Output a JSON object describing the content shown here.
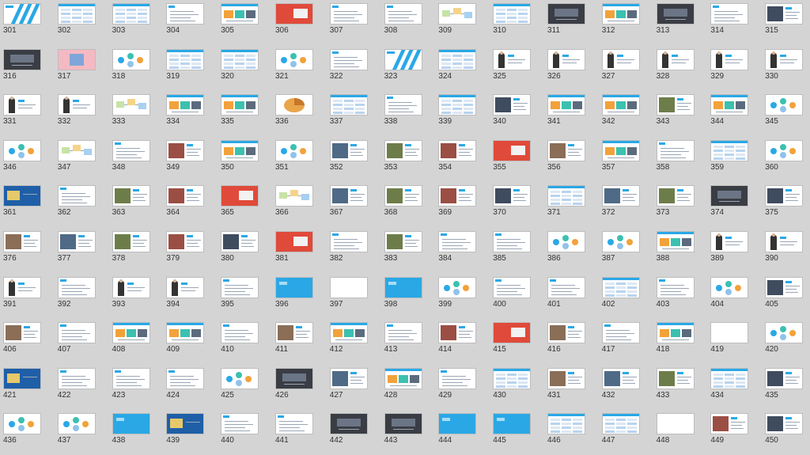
{
  "view": "slide-sorter",
  "slides": [
    {
      "n": "301",
      "s": "stripes"
    },
    {
      "n": "302",
      "s": "table"
    },
    {
      "n": "303",
      "s": "table"
    },
    {
      "n": "304",
      "s": "text"
    },
    {
      "n": "305",
      "s": "tiles"
    },
    {
      "n": "306",
      "s": "photo-red"
    },
    {
      "n": "307",
      "s": "text"
    },
    {
      "n": "308",
      "s": "text"
    },
    {
      "n": "309",
      "s": "diagram"
    },
    {
      "n": "310",
      "s": "table"
    },
    {
      "n": "311",
      "s": "photo-dark"
    },
    {
      "n": "312",
      "s": "tiles"
    },
    {
      "n": "313",
      "s": "photo-dark"
    },
    {
      "n": "314",
      "s": "text"
    },
    {
      "n": "315",
      "s": "photo"
    },
    {
      "n": "316",
      "s": "photo-dark"
    },
    {
      "n": "317",
      "s": "photo-pink"
    },
    {
      "n": "318",
      "s": "circles"
    },
    {
      "n": "319",
      "s": "table"
    },
    {
      "n": "320",
      "s": "table"
    },
    {
      "n": "321",
      "s": "circles"
    },
    {
      "n": "322",
      "s": "text"
    },
    {
      "n": "323",
      "s": "stripes"
    },
    {
      "n": "324",
      "s": "table"
    },
    {
      "n": "325",
      "s": "person"
    },
    {
      "n": "326",
      "s": "person"
    },
    {
      "n": "327",
      "s": "person"
    },
    {
      "n": "328",
      "s": "person"
    },
    {
      "n": "329",
      "s": "person"
    },
    {
      "n": "330",
      "s": "person"
    },
    {
      "n": "331",
      "s": "person"
    },
    {
      "n": "332",
      "s": "person"
    },
    {
      "n": "333",
      "s": "diagram"
    },
    {
      "n": "334",
      "s": "tiles"
    },
    {
      "n": "335",
      "s": "tiles"
    },
    {
      "n": "336",
      "s": "chart"
    },
    {
      "n": "337",
      "s": "table"
    },
    {
      "n": "338",
      "s": "text"
    },
    {
      "n": "339",
      "s": "table"
    },
    {
      "n": "340",
      "s": "photo"
    },
    {
      "n": "341",
      "s": "tiles"
    },
    {
      "n": "342",
      "s": "tiles"
    },
    {
      "n": "343",
      "s": "photo"
    },
    {
      "n": "344",
      "s": "tiles"
    },
    {
      "n": "345",
      "s": "circles"
    },
    {
      "n": "346",
      "s": "circles"
    },
    {
      "n": "347",
      "s": "diagram"
    },
    {
      "n": "348",
      "s": "text"
    },
    {
      "n": "349",
      "s": "photo"
    },
    {
      "n": "350",
      "s": "tiles"
    },
    {
      "n": "351",
      "s": "circles"
    },
    {
      "n": "352",
      "s": "photo"
    },
    {
      "n": "353",
      "s": "photo"
    },
    {
      "n": "354",
      "s": "photo"
    },
    {
      "n": "355",
      "s": "photo-red"
    },
    {
      "n": "356",
      "s": "photo"
    },
    {
      "n": "357",
      "s": "tiles"
    },
    {
      "n": "358",
      "s": "text"
    },
    {
      "n": "359",
      "s": "table"
    },
    {
      "n": "360",
      "s": "circles"
    },
    {
      "n": "361",
      "s": "photo-blue"
    },
    {
      "n": "362",
      "s": "text"
    },
    {
      "n": "363",
      "s": "photo"
    },
    {
      "n": "364",
      "s": "photo"
    },
    {
      "n": "365",
      "s": "photo-red"
    },
    {
      "n": "366",
      "s": "diagram"
    },
    {
      "n": "367",
      "s": "photo"
    },
    {
      "n": "368",
      "s": "photo"
    },
    {
      "n": "369",
      "s": "photo"
    },
    {
      "n": "370",
      "s": "photo"
    },
    {
      "n": "371",
      "s": "table"
    },
    {
      "n": "372",
      "s": "photo"
    },
    {
      "n": "373",
      "s": "photo"
    },
    {
      "n": "374",
      "s": "photo-dark"
    },
    {
      "n": "375",
      "s": "photo"
    },
    {
      "n": "376",
      "s": "photo"
    },
    {
      "n": "377",
      "s": "photo"
    },
    {
      "n": "378",
      "s": "photo"
    },
    {
      "n": "379",
      "s": "photo"
    },
    {
      "n": "380",
      "s": "photo"
    },
    {
      "n": "381",
      "s": "photo-red"
    },
    {
      "n": "382",
      "s": "text"
    },
    {
      "n": "383",
      "s": "photo"
    },
    {
      "n": "384",
      "s": "text"
    },
    {
      "n": "385",
      "s": "text"
    },
    {
      "n": "386",
      "s": "circles"
    },
    {
      "n": "387",
      "s": "circles"
    },
    {
      "n": "388",
      "s": "tiles"
    },
    {
      "n": "389",
      "s": "person"
    },
    {
      "n": "390",
      "s": "person"
    },
    {
      "n": "391",
      "s": "person"
    },
    {
      "n": "392",
      "s": "text"
    },
    {
      "n": "393",
      "s": "person"
    },
    {
      "n": "394",
      "s": "person"
    },
    {
      "n": "395",
      "s": "text"
    },
    {
      "n": "396",
      "s": "solid-blue"
    },
    {
      "n": "397",
      "s": "blank"
    },
    {
      "n": "398",
      "s": "solid-blue"
    },
    {
      "n": "399",
      "s": "circles"
    },
    {
      "n": "400",
      "s": "text"
    },
    {
      "n": "401",
      "s": "text"
    },
    {
      "n": "402",
      "s": "table"
    },
    {
      "n": "403",
      "s": "text"
    },
    {
      "n": "404",
      "s": "circles"
    },
    {
      "n": "405",
      "s": "photo"
    },
    {
      "n": "406",
      "s": "photo"
    },
    {
      "n": "407",
      "s": "text"
    },
    {
      "n": "408",
      "s": "tiles"
    },
    {
      "n": "409",
      "s": "tiles"
    },
    {
      "n": "410",
      "s": "text"
    },
    {
      "n": "411",
      "s": "photo"
    },
    {
      "n": "412",
      "s": "tiles"
    },
    {
      "n": "413",
      "s": "text"
    },
    {
      "n": "414",
      "s": "photo"
    },
    {
      "n": "415",
      "s": "photo-red"
    },
    {
      "n": "416",
      "s": "photo"
    },
    {
      "n": "417",
      "s": "text"
    },
    {
      "n": "418",
      "s": "tiles"
    },
    {
      "n": "419",
      "s": "blank"
    },
    {
      "n": "420",
      "s": "circles"
    },
    {
      "n": "421",
      "s": "photo-blue"
    },
    {
      "n": "422",
      "s": "text"
    },
    {
      "n": "423",
      "s": "text"
    },
    {
      "n": "424",
      "s": "text"
    },
    {
      "n": "425",
      "s": "circles"
    },
    {
      "n": "426",
      "s": "photo-dark"
    },
    {
      "n": "427",
      "s": "photo"
    },
    {
      "n": "428",
      "s": "tiles"
    },
    {
      "n": "429",
      "s": "text"
    },
    {
      "n": "430",
      "s": "table"
    },
    {
      "n": "431",
      "s": "photo"
    },
    {
      "n": "432",
      "s": "photo"
    },
    {
      "n": "433",
      "s": "photo"
    },
    {
      "n": "434",
      "s": "table"
    },
    {
      "n": "435",
      "s": "photo"
    },
    {
      "n": "436",
      "s": "circles"
    },
    {
      "n": "437",
      "s": "circles"
    },
    {
      "n": "438",
      "s": "solid-blue"
    },
    {
      "n": "439",
      "s": "photo-blue"
    },
    {
      "n": "440",
      "s": "text"
    },
    {
      "n": "441",
      "s": "text"
    },
    {
      "n": "442",
      "s": "photo-dark"
    },
    {
      "n": "443",
      "s": "photo-dark"
    },
    {
      "n": "444",
      "s": "solid-blue"
    },
    {
      "n": "445",
      "s": "solid-blue"
    },
    {
      "n": "446",
      "s": "table"
    },
    {
      "n": "447",
      "s": "table"
    },
    {
      "n": "448",
      "s": "blank"
    },
    {
      "n": "449",
      "s": "photo"
    },
    {
      "n": "450",
      "s": "photo"
    }
  ],
  "palette": {
    "background": "#d4d4d4",
    "blue": "#2aa8e6",
    "dark": "#2a2a2a",
    "red": "#e04a3a",
    "pink": "#f4b9c2",
    "orange": "#f2a23a",
    "teal": "#3cc0b0"
  }
}
